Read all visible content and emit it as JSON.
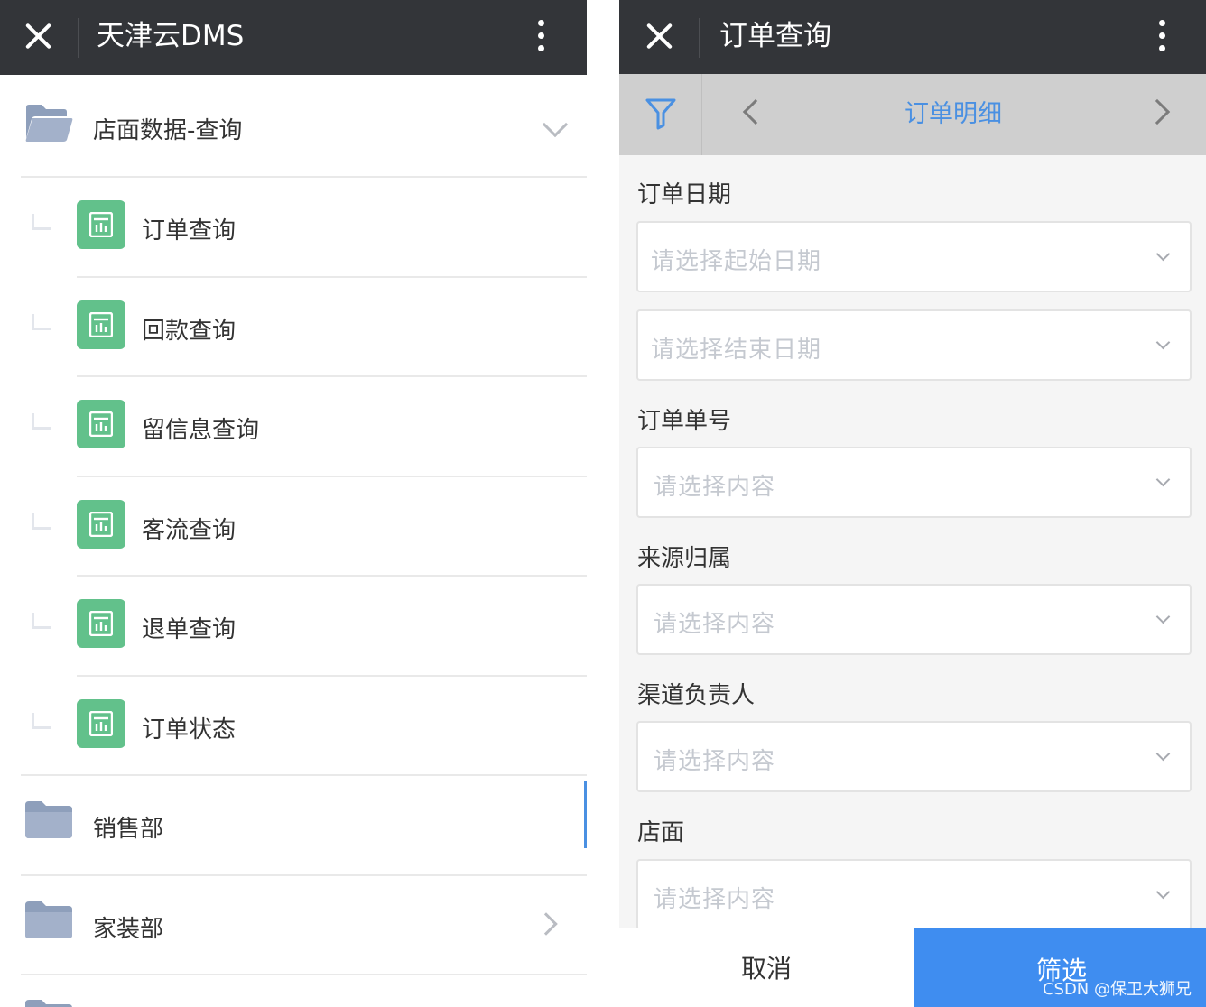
{
  "left": {
    "title": "天津云DMS",
    "group_expanded": {
      "label": "店面数据-查询",
      "icon": "folder-open-icon"
    },
    "children": [
      {
        "label": "订单查询",
        "icon": "report-icon"
      },
      {
        "label": "回款查询",
        "icon": "report-icon"
      },
      {
        "label": "留信息查询",
        "icon": "report-icon"
      },
      {
        "label": "客流查询",
        "icon": "report-icon"
      },
      {
        "label": "退单查询",
        "icon": "report-icon"
      },
      {
        "label": "订单状态",
        "icon": "report-icon"
      }
    ],
    "folders": [
      {
        "label": "销售部",
        "icon": "folder-icon"
      },
      {
        "label": "家装部",
        "icon": "folder-icon"
      }
    ]
  },
  "right": {
    "title": "订单查询",
    "nav_title": "订单明细",
    "fields": {
      "order_date": {
        "label": "订单日期",
        "start_placeholder": "请选择起始日期",
        "end_placeholder": "请选择结束日期"
      },
      "order_no": {
        "label": "订单单号",
        "placeholder": "请选择内容"
      },
      "source": {
        "label": "来源归属",
        "placeholder": "请选择内容"
      },
      "channel_owner": {
        "label": "渠道负责人",
        "placeholder": "请选择内容"
      },
      "store": {
        "label": "店面",
        "placeholder": "请选择内容"
      }
    },
    "cancel_label": "取消",
    "filter_label": "筛选",
    "watermark": "CSDN @保卫大狮兄"
  },
  "colors": {
    "topbar": "#333539",
    "report_icon": "#62c18b",
    "folder_icon": "#9aaac4",
    "accent": "#4a90e2",
    "filter_button": "#3f8df0"
  }
}
